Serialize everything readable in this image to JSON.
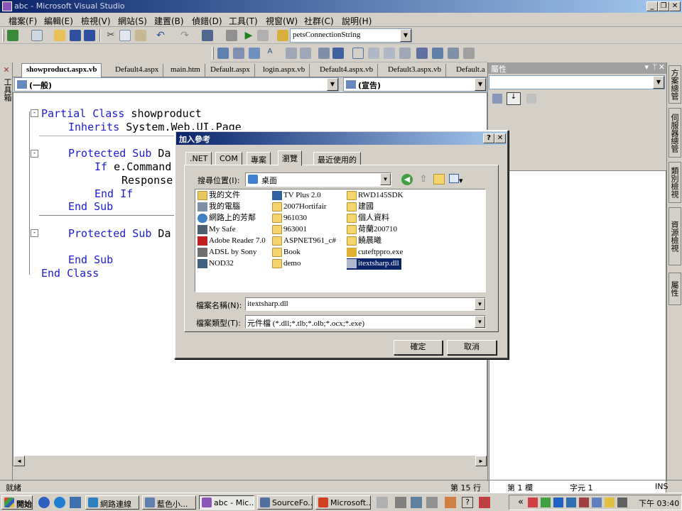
{
  "window": {
    "title": "abc - Microsoft Visual Studio"
  },
  "menu": [
    "檔案(F)",
    "編輯(E)",
    "檢視(V)",
    "網站(S)",
    "建置(B)",
    "偵錯(D)",
    "工具(T)",
    "視窗(W)",
    "社群(C)",
    "說明(H)"
  ],
  "toolbar": {
    "connection_combo": "petsConnectionString"
  },
  "doc_tabs": [
    "showproduct.aspx.vb",
    "Default4.aspx",
    "main.htm",
    "Default.aspx",
    "login.aspx.vb",
    "Default4.aspx.vb",
    "Default3.aspx.vb",
    "Default.a"
  ],
  "editor": {
    "class_combo": "(一般)",
    "method_combo": "(宣告)",
    "lines": [
      {
        "kw": "Partial Class",
        "text": " showproduct"
      },
      {
        "kw": "Inherits",
        "text": " System.Web.UI.Page"
      },
      {
        "kw": "Protected Sub",
        "text": " Da"
      },
      {
        "kw": "If",
        "text": " e.Command"
      },
      {
        "kw": "",
        "text": "Response"
      },
      {
        "kw": "End If",
        "text": ""
      },
      {
        "kw": "End Sub",
        "text": ""
      },
      {
        "kw": "Protected Sub",
        "text": " Da"
      },
      {
        "kw": "End Sub",
        "text": ""
      },
      {
        "kw": "End Class",
        "text": ""
      }
    ]
  },
  "toolbox_label": "工具箱",
  "properties": {
    "header": "屬性"
  },
  "right_tabs": [
    "方案總管",
    "伺服器總管",
    "類別檢視",
    "資源檢視",
    "屬性"
  ],
  "dialog": {
    "title": "加入參考",
    "tabs": [
      ".NET",
      "COM",
      "專案",
      "瀏覽",
      "最近使用的"
    ],
    "active_tab": "瀏覽",
    "lookin_label": "搜尋位置(I):",
    "lookin_value": "桌面",
    "files_col1": [
      "我的文件",
      "我的電腦",
      "網路上的芳鄰",
      "My Safe",
      "Adobe Reader 7.0",
      "ADSL by Sony",
      "NOD32"
    ],
    "files_col2": [
      "TV Plus 2.0",
      "2007Hortifair",
      "961030",
      "963001",
      "ASPNET961_c#",
      "Book",
      "demo"
    ],
    "files_col3": [
      "RWD145SDK",
      "建國",
      "個人資料",
      "荷蘭200710",
      "饒晨曦",
      "cuteftppro.exe",
      "itextsharp.dll"
    ],
    "filename_label": "檔案名稱(N):",
    "filename_value": "itextsharp.dll",
    "filetype_label": "檔案類型(T):",
    "filetype_value": "元件檔 (*.dll;*.tlb;*.olb;*.ocx;*.exe)",
    "ok": "確定",
    "cancel": "取消"
  },
  "status": {
    "ready": "就緒",
    "line": "第 15 行",
    "col": "第 1 欄",
    "ch": "字元 1",
    "mode": "INS"
  },
  "taskbar": {
    "start": "開始",
    "items": [
      "網路連線",
      "藍色小...",
      "abc - Mic...",
      "SourceFo...",
      "Microsoft..."
    ],
    "clock": "下午 03:40"
  }
}
